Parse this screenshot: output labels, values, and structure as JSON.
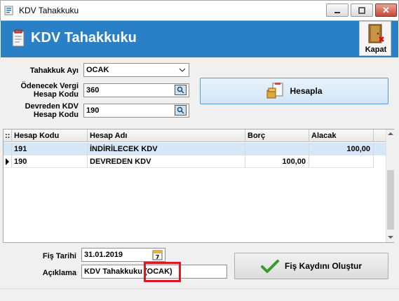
{
  "window": {
    "title": "KDV Tahakkuku",
    "controls": {
      "minimize": "",
      "maximize": "",
      "close": "✕"
    }
  },
  "header": {
    "title": "KDV Tahakkuku",
    "kapat_label": "Kapat"
  },
  "form": {
    "tahakkuk_ayi_label": "Tahakkuk Ayı",
    "tahakkuk_ayi_value": "OCAK",
    "odenecek_label_1": "Ödenecek Vergi",
    "odenecek_label_2": "Hesap Kodu",
    "odenecek_value": "360",
    "devreden_label_1": "Devreden KDV",
    "devreden_label_2": "Hesap Kodu",
    "devreden_value": "190",
    "hesapla_label": "Hesapla"
  },
  "grid": {
    "columns": [
      "Hesap Kodu",
      "Hesap Adı",
      "Borç",
      "Alacak"
    ],
    "rows": [
      {
        "hesap_kodu": "191",
        "hesap_adi": "İNDİRİLECEK KDV",
        "borc": "",
        "alacak": "100,00",
        "selected": true
      },
      {
        "hesap_kodu": "190",
        "hesap_adi": "DEVREDEN KDV",
        "borc": "100,00",
        "alacak": "",
        "current": true
      }
    ]
  },
  "footer": {
    "fis_tarihi_label": "Fiş Tarihi",
    "fis_tarihi_value": "31.01.2019",
    "aciklama_label": "Açıklama",
    "aciklama_value": "KDV Tahakkuku (OCAK)",
    "calendar_day": "7",
    "fis_button_label": "Fiş Kaydını Oluştur"
  },
  "colors": {
    "header_bg": "#2a80c6",
    "selected_row": "#d6e7f7",
    "highlight": "#e0151d"
  }
}
